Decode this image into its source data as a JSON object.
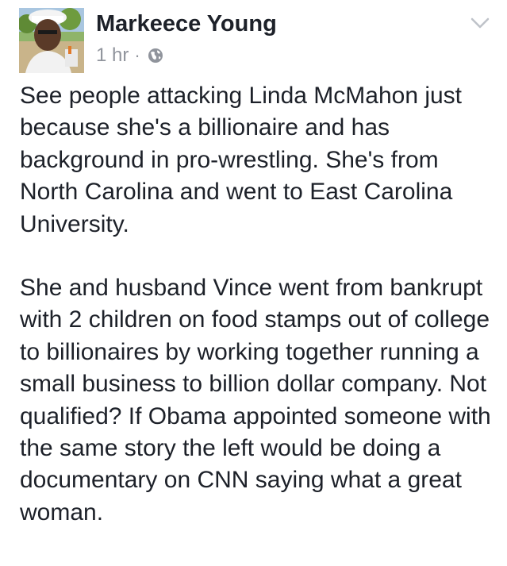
{
  "post": {
    "author": "Markeece Young",
    "timestamp": "1 hr",
    "separator": "·",
    "audience_icon": "globe-icon",
    "menu_icon": "chevron-down-icon",
    "paragraphs": [
      "See people attacking Linda McMahon just because she's a billionaire and has background in pro-wrestling. She's from North Carolina and went to East Carolina University.",
      "She and husband Vince went from bankrupt with 2 children on food stamps out of college to billionaires by working together running a small business to billion dollar company. Not qualified? If Obama appointed someone with the same story the left would be doing a documentary on CNN saying what a great woman."
    ]
  },
  "colors": {
    "text": "#1d2129",
    "meta": "#90949c",
    "chevron": "#bec2c9"
  }
}
